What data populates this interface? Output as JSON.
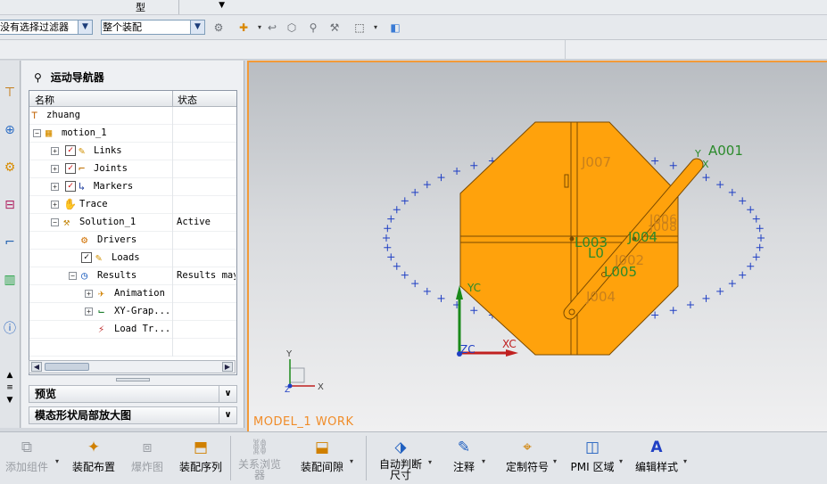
{
  "topstrip": {
    "label": "型"
  },
  "toolbar": {
    "filter_value": "没有选择过滤器",
    "scope_value": "整个装配"
  },
  "navigator": {
    "title": "运动导航器",
    "col_name": "名称",
    "col_status": "状态",
    "rows": [
      {
        "label": "zhuang",
        "status": ""
      },
      {
        "label": "motion_1",
        "status": ""
      },
      {
        "label": "Links",
        "status": ""
      },
      {
        "label": "Joints",
        "status": ""
      },
      {
        "label": "Markers",
        "status": ""
      },
      {
        "label": "Trace",
        "status": ""
      },
      {
        "label": "Solution_1",
        "status": "Active"
      },
      {
        "label": "Drivers",
        "status": ""
      },
      {
        "label": "Loads",
        "status": ""
      },
      {
        "label": "Results",
        "status": "Results may"
      },
      {
        "label": "Animation",
        "status": ""
      },
      {
        "label": "XY-Grap...",
        "status": ""
      },
      {
        "label": "Load Tr...",
        "status": ""
      }
    ],
    "preview_label": "预览",
    "modal_label": "模态形状局部放大图"
  },
  "viewport": {
    "work_label": "MODEL_1 WORK",
    "labels": {
      "a001": "A001",
      "j007": "J007",
      "j006": "J006",
      "j008": "J008",
      "j004a": "J004",
      "j003": "L003",
      "l0": "L0",
      "j002": "J002",
      "l005": "L005",
      "j004b": "J004",
      "xc": "XC",
      "yc": "YC",
      "zc": "ZC",
      "ax_x": "X",
      "ax_y": "Y",
      "ax_z": "Z",
      "ya": "Y",
      "xa": "X"
    }
  },
  "ribbon": {
    "items": [
      {
        "label": "添加组件",
        "icon": "add-component-icon",
        "enabled": false
      },
      {
        "label": "装配布置",
        "icon": "arrangement-icon",
        "enabled": true
      },
      {
        "label": "爆炸图",
        "icon": "exploded-view-icon",
        "enabled": false
      },
      {
        "label": "装配序列",
        "icon": "sequence-icon",
        "enabled": true
      },
      {
        "label": "关系浏览",
        "label2": "器",
        "icon": "relationship-browser-icon",
        "enabled": false
      },
      {
        "label": "装配间隙",
        "icon": "clearance-icon",
        "enabled": true
      },
      {
        "label": "自动判断",
        "label2": "尺寸",
        "icon": "inferred-dimension-icon",
        "enabled": true
      },
      {
        "label": "注释",
        "icon": "annotation-icon",
        "enabled": true
      },
      {
        "label": "定制符号",
        "icon": "custom-symbol-icon",
        "enabled": true
      },
      {
        "label": "PMI 区域",
        "icon": "pmi-region-icon",
        "enabled": true
      },
      {
        "label": "编辑样式",
        "icon": "edit-style-icon",
        "enabled": true
      }
    ]
  },
  "colors": {
    "accent": "#f29a38",
    "part": "#ffa20c",
    "marker_blue": "#1f3fc4",
    "label_green": "#2b8a2b"
  }
}
